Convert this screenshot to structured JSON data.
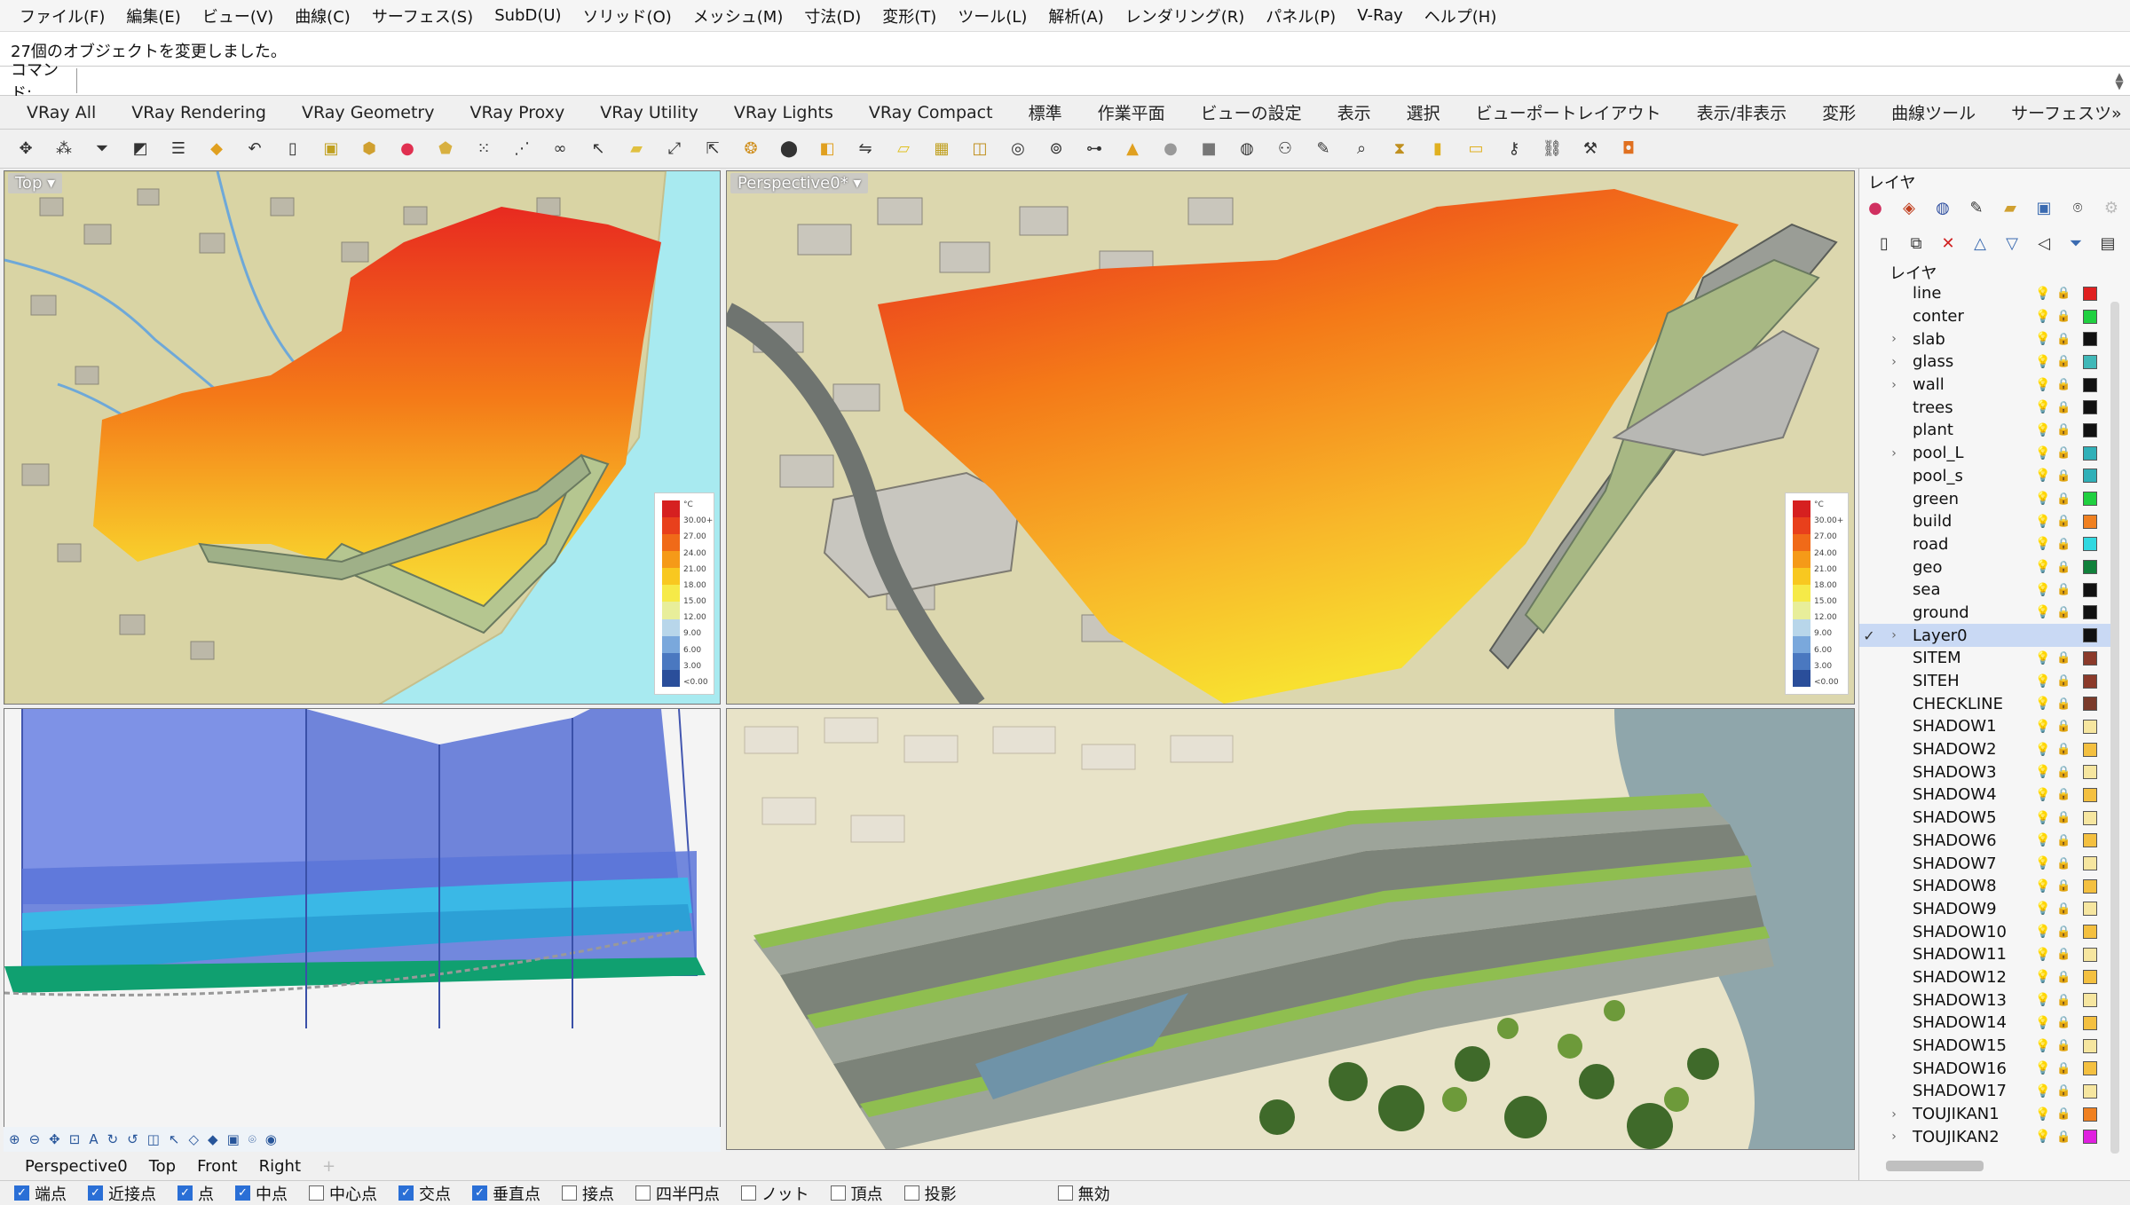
{
  "menu": [
    "ファイル(F)",
    "編集(E)",
    "ビュー(V)",
    "曲線(C)",
    "サーフェス(S)",
    "SubD(U)",
    "ソリッド(O)",
    "メッシュ(M)",
    "寸法(D)",
    "変形(T)",
    "ツール(L)",
    "解析(A)",
    "レンダリング(R)",
    "パネル(P)",
    "V-Ray",
    "ヘルプ(H)"
  ],
  "status_message": "27個のオブジェクトを変更しました。",
  "command": {
    "label": "コマンド:",
    "value": ""
  },
  "toolbar_tabs": [
    "VRay All",
    "VRay Rendering",
    "VRay Geometry",
    "VRay Proxy",
    "VRay Utility",
    "VRay Lights",
    "VRay Compact",
    "標準",
    "作業平面",
    "ビューの設定",
    "表示",
    "選択",
    "ビューポートレイアウト",
    "表示/非表示",
    "変形",
    "曲線ツール",
    "サーフェスツ»"
  ],
  "viewports": {
    "top": {
      "label": "Top ▾"
    },
    "perspective": {
      "label": "Perspective0* ▾"
    }
  },
  "legend": {
    "colors": [
      "#d62020",
      "#e8401c",
      "#f06a18",
      "#f59a18",
      "#f8c820",
      "#f6ea48",
      "#e8ee9a",
      "#b8d6ea",
      "#7aa8dc",
      "#4a78c0",
      "#2a4e9a"
    ],
    "ticks": [
      "°C",
      "30.00+",
      "27.00",
      "24.00",
      "21.00",
      "18.00",
      "15.00",
      "12.00",
      "9.00",
      "6.00",
      "3.00",
      "<0.00"
    ]
  },
  "view_tabs": [
    "Perspective0",
    "Top",
    "Front",
    "Right",
    "+"
  ],
  "osnaps": [
    {
      "label": "端点",
      "checked": true
    },
    {
      "label": "近接点",
      "checked": true
    },
    {
      "label": "点",
      "checked": true
    },
    {
      "label": "中点",
      "checked": true
    },
    {
      "label": "中心点",
      "checked": false
    },
    {
      "label": "交点",
      "checked": true
    },
    {
      "label": "垂直点",
      "checked": true
    },
    {
      "label": "接点",
      "checked": false
    },
    {
      "label": "四半円点",
      "checked": false
    },
    {
      "label": "ノット",
      "checked": false
    },
    {
      "label": "頂点",
      "checked": false
    },
    {
      "label": "投影",
      "checked": false
    },
    {
      "label": "無効",
      "checked": false
    }
  ],
  "layer_panel": {
    "title": "レイヤ",
    "header": "レイヤ",
    "layers": [
      {
        "name": "line",
        "color": "#e02020",
        "expandable": false,
        "current": false
      },
      {
        "name": "conter",
        "color": "#20d040",
        "expandable": false,
        "current": false
      },
      {
        "name": "slab",
        "color": "#111111",
        "expandable": true,
        "current": false
      },
      {
        "name": "glass",
        "color": "#40b8b8",
        "expandable": true,
        "current": false
      },
      {
        "name": "wall",
        "color": "#111111",
        "expandable": true,
        "current": false
      },
      {
        "name": "trees",
        "color": "#111111",
        "expandable": false,
        "current": false
      },
      {
        "name": "plant",
        "color": "#111111",
        "expandable": false,
        "current": false
      },
      {
        "name": "pool_L",
        "color": "#30b0b8",
        "expandable": true,
        "current": false
      },
      {
        "name": "pool_s",
        "color": "#30b0b8",
        "expandable": false,
        "current": false
      },
      {
        "name": "green",
        "color": "#20d040",
        "expandable": false,
        "current": false
      },
      {
        "name": "build",
        "color": "#f08020",
        "expandable": false,
        "current": false
      },
      {
        "name": "road",
        "color": "#30d8e0",
        "expandable": false,
        "current": false
      },
      {
        "name": "geo",
        "color": "#10803a",
        "expandable": false,
        "current": false
      },
      {
        "name": "sea",
        "color": "#111111",
        "expandable": false,
        "current": false
      },
      {
        "name": "ground",
        "color": "#111111",
        "expandable": false,
        "current": false
      },
      {
        "name": "Layer0",
        "color": "#111111",
        "expandable": true,
        "current": true
      },
      {
        "name": "SITEM",
        "color": "#8b3a2a",
        "expandable": false,
        "current": false
      },
      {
        "name": "SITEH",
        "color": "#8b3a2a",
        "expandable": false,
        "current": false
      },
      {
        "name": "CHECKLINE",
        "color": "#7a3a2a",
        "expandable": false,
        "current": false
      },
      {
        "name": "SHADOW1",
        "color": "#f6e6a0",
        "expandable": false,
        "current": false
      },
      {
        "name": "SHADOW2",
        "color": "#f4c040",
        "expandable": false,
        "current": false
      },
      {
        "name": "SHADOW3",
        "color": "#f6e6a0",
        "expandable": false,
        "current": false
      },
      {
        "name": "SHADOW4",
        "color": "#f4c040",
        "expandable": false,
        "current": false
      },
      {
        "name": "SHADOW5",
        "color": "#f6e6a0",
        "expandable": false,
        "current": false
      },
      {
        "name": "SHADOW6",
        "color": "#f4c040",
        "expandable": false,
        "current": false
      },
      {
        "name": "SHADOW7",
        "color": "#f6e6a0",
        "expandable": false,
        "current": false
      },
      {
        "name": "SHADOW8",
        "color": "#f4c040",
        "expandable": false,
        "current": false
      },
      {
        "name": "SHADOW9",
        "color": "#f6e6a0",
        "expandable": false,
        "current": false
      },
      {
        "name": "SHADOW10",
        "color": "#f4c040",
        "expandable": false,
        "current": false
      },
      {
        "name": "SHADOW11",
        "color": "#f6e6a0",
        "expandable": false,
        "current": false
      },
      {
        "name": "SHADOW12",
        "color": "#f4c040",
        "expandable": false,
        "current": false
      },
      {
        "name": "SHADOW13",
        "color": "#f6e6a0",
        "expandable": false,
        "current": false
      },
      {
        "name": "SHADOW14",
        "color": "#f4c040",
        "expandable": false,
        "current": false
      },
      {
        "name": "SHADOW15",
        "color": "#f6e6a0",
        "expandable": false,
        "current": false
      },
      {
        "name": "SHADOW16",
        "color": "#f4c040",
        "expandable": false,
        "current": false
      },
      {
        "name": "SHADOW17",
        "color": "#f6e6a0",
        "expandable": false,
        "current": false
      },
      {
        "name": "TOUJIKAN1",
        "color": "#f08020",
        "expandable": true,
        "current": false
      },
      {
        "name": "TOUJIKAN2",
        "color": "#e020e0",
        "expandable": true,
        "current": false
      }
    ]
  }
}
